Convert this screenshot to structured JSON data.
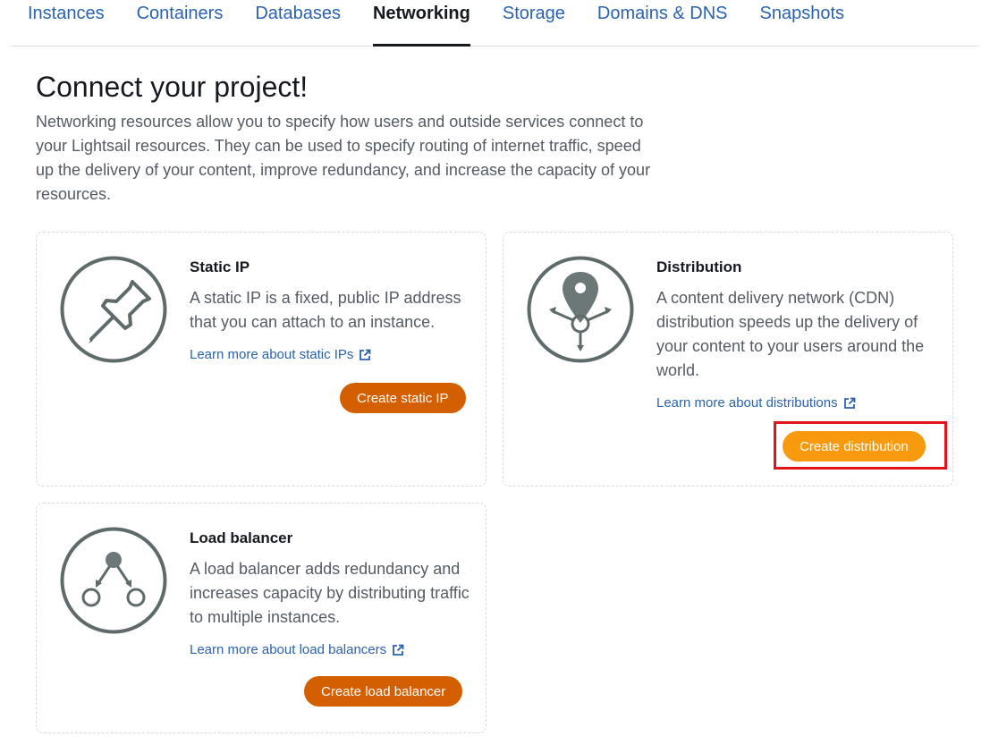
{
  "tabs": [
    {
      "label": "Instances",
      "active": false
    },
    {
      "label": "Containers",
      "active": false
    },
    {
      "label": "Databases",
      "active": false
    },
    {
      "label": "Networking",
      "active": true
    },
    {
      "label": "Storage",
      "active": false
    },
    {
      "label": "Domains & DNS",
      "active": false
    },
    {
      "label": "Snapshots",
      "active": false
    }
  ],
  "page": {
    "title": "Connect your project!",
    "intro": "Networking resources allow you to specify how users and outside services connect to your Lightsail resources. They can be used to specify routing of internet traffic, speed up the delivery of your content, improve redundancy, and increase the capacity of your resources."
  },
  "cards": {
    "static_ip": {
      "icon": "pushpin-icon",
      "title": "Static IP",
      "description": "A static IP is a fixed, public IP address that you can attach to an instance.",
      "link": "Learn more about static IPs",
      "button": "Create static IP"
    },
    "distribution": {
      "icon": "map-pin-distribution-icon",
      "title": "Distribution",
      "description": "A content delivery network (CDN) distribution speeds up the delivery of your content to your users around the world.",
      "link": "Learn more about distributions",
      "button": "Create distribution"
    },
    "load_balancer": {
      "icon": "load-balancer-icon",
      "title": "Load balancer",
      "description": "A load balancer adds redundancy and increases capacity by distributing traffic to multiple instances.",
      "link": "Learn more about load balancers",
      "button": "Create load balancer"
    }
  },
  "colors": {
    "link": "#2b62ac",
    "button": "#d45f00",
    "button_highlighted": "#f89a0e",
    "highlight_box": "#e1141b",
    "icon_gray": "#5f6b6b"
  }
}
